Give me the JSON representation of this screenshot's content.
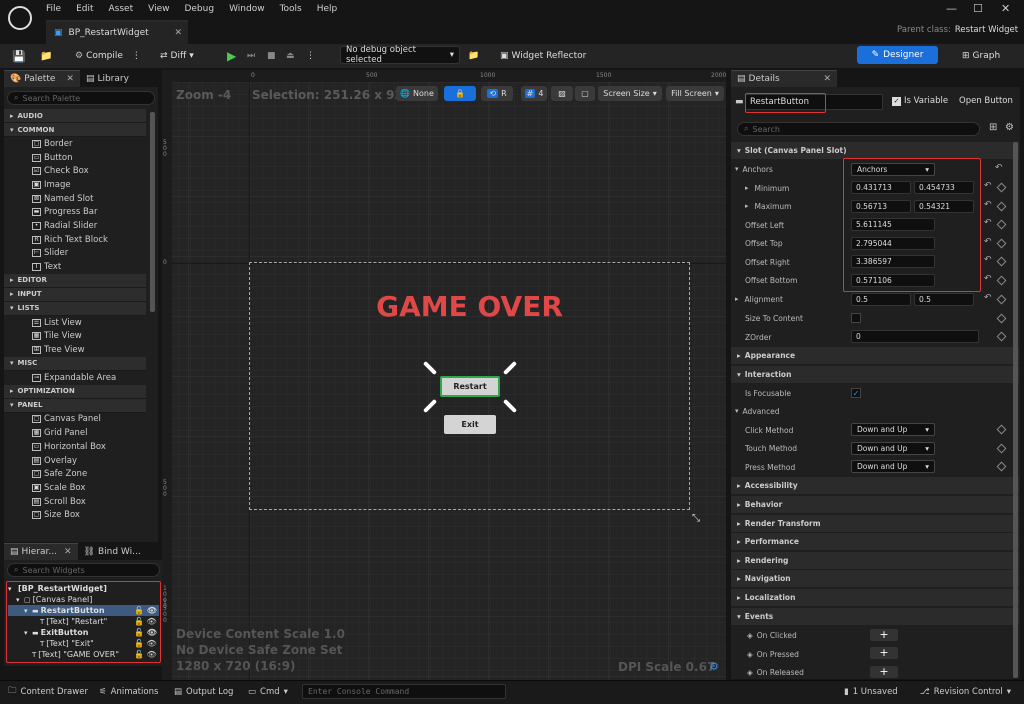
{
  "menu": [
    "File",
    "Edit",
    "Asset",
    "View",
    "Debug",
    "Window",
    "Tools",
    "Help"
  ],
  "document_tab": "BP_RestartWidget",
  "parent_class_label": "Parent class:",
  "parent_class_value": "Restart Widget",
  "toolbar": {
    "compile": "Compile",
    "diff": "Diff",
    "debug_object": "No debug object selected",
    "widget_reflector": "Widget Reflector",
    "designer": "Designer",
    "graph": "Graph"
  },
  "palette": {
    "tab_palette": "Palette",
    "tab_library": "Library",
    "search_placeholder": "Search Palette",
    "categories": [
      {
        "name": "AUDIO",
        "items": []
      },
      {
        "name": "COMMON",
        "items": [
          "Border",
          "Button",
          "Check Box",
          "Image",
          "Named Slot",
          "Progress Bar",
          "Radial Slider",
          "Rich Text Block",
          "Slider",
          "Text"
        ]
      },
      {
        "name": "EDITOR",
        "items": []
      },
      {
        "name": "INPUT",
        "items": []
      },
      {
        "name": "LISTS",
        "items": [
          "List View",
          "Tile View",
          "Tree View"
        ]
      },
      {
        "name": "MISC",
        "items": [
          "Expandable Area"
        ]
      },
      {
        "name": "OPTIMIZATION",
        "items": []
      },
      {
        "name": "PANEL",
        "items": [
          "Canvas Panel",
          "Grid Panel",
          "Horizontal Box",
          "Overlay",
          "Safe Zone",
          "Scale Box",
          "Scroll Box",
          "Size Box"
        ]
      }
    ]
  },
  "hierarchy": {
    "tab_hierarchy": "Hierar...",
    "tab_bind": "Bind Wi...",
    "search_placeholder": "Search Widgets",
    "rows": [
      {
        "label": "[BP_RestartWidget]",
        "indent": 0
      },
      {
        "label": "[Canvas Panel]",
        "indent": 1
      },
      {
        "label": "RestartButton",
        "indent": 2
      },
      {
        "label": "[Text] \"Restart\"",
        "indent": 3
      },
      {
        "label": "ExitButton",
        "indent": 2
      },
      {
        "label": "[Text] \"Exit\"",
        "indent": 3
      },
      {
        "label": "[Text] \"GAME OVER\"",
        "indent": 2
      }
    ]
  },
  "viewport": {
    "zoom": "Zoom -4",
    "selection": "Selection: 251.26 x 92.28",
    "none": "None",
    "r": "R",
    "grid_snap": "4",
    "screen_size": "Screen Size",
    "fill_screen": "Fill Screen",
    "ruler_top": [
      "0",
      "500",
      "1000",
      "1500",
      "2000"
    ],
    "ruler_left": [
      "500",
      "0",
      "500",
      "1000",
      "1500"
    ],
    "game_over": "GAME OVER",
    "restart": "Restart",
    "exit": "Exit",
    "info_line1": "Device Content Scale 1.0",
    "info_line2": "No Device Safe Zone Set",
    "info_line3": "1280 x 720 (16:9)",
    "dpi": "DPI Scale 0.67"
  },
  "details": {
    "tab": "Details",
    "name": "RestartButton",
    "is_variable": "Is Variable",
    "open_button": "Open Button",
    "search_placeholder": "Search",
    "slot_section": "Slot (Canvas Panel Slot)",
    "anchors_label": "Anchors",
    "anchors_value": "Anchors",
    "minimum_label": "Minimum",
    "minimum": [
      "0.431713",
      "0.454733"
    ],
    "maximum_label": "Maximum",
    "maximum": [
      "0.56713",
      "0.54321"
    ],
    "offset_left_label": "Offset Left",
    "offset_left": "5.611145",
    "offset_top_label": "Offset Top",
    "offset_top": "2.795044",
    "offset_right_label": "Offset Right",
    "offset_right": "3.386597",
    "offset_bottom_label": "Offset Bottom",
    "offset_bottom": "0.571106",
    "alignment_label": "Alignment",
    "alignment": [
      "0.5",
      "0.5"
    ],
    "size_to_content_label": "Size To Content",
    "zorder_label": "ZOrder",
    "zorder": "0",
    "appearance": "Appearance",
    "interaction": "Interaction",
    "is_focusable": "Is Focusable",
    "advanced": "Advanced",
    "click_method_label": "Click Method",
    "click_method": "Down and Up",
    "touch_method_label": "Touch Method",
    "touch_method": "Down and Up",
    "press_method_label": "Press Method",
    "press_method": "Down and Up",
    "accessibility": "Accessibility",
    "behavior": "Behavior",
    "render_transform": "Render Transform",
    "performance": "Performance",
    "rendering": "Rendering",
    "navigation": "Navigation",
    "localization": "Localization",
    "events": "Events",
    "on_clicked": "On Clicked",
    "on_pressed": "On Pressed",
    "on_released": "On Released"
  },
  "statusbar": {
    "content_drawer": "Content Drawer",
    "animations": "Animations",
    "output_log": "Output Log",
    "cmd": "Cmd",
    "console_placeholder": "Enter Console Command",
    "unsaved": "1 Unsaved",
    "revision_control": "Revision Control"
  },
  "colors": {
    "accent_blue": "#1a6fdb",
    "game_over_red": "#e04848",
    "highlight_red": "#e03434",
    "selection_green": "#2ea84a"
  }
}
